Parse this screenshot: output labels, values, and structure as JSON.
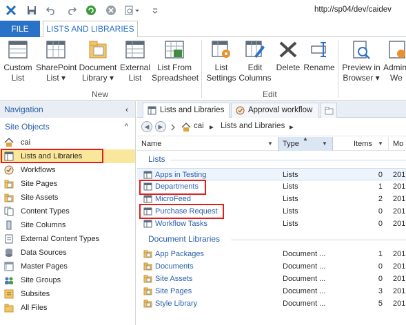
{
  "url": "http://sp04/dev/caidev",
  "tabs": {
    "file": "FILE",
    "active": "LISTS AND LIBRARIES"
  },
  "ribbon": {
    "new_group": "New",
    "edit_group": "Edit",
    "buttons": [
      {
        "line1": "Custom",
        "line2": "List"
      },
      {
        "line1": "SharePoint",
        "line2": "List ▾"
      },
      {
        "line1": "Document",
        "line2": "Library ▾"
      },
      {
        "line1": "External",
        "line2": "List"
      },
      {
        "line1": "List From",
        "line2": "Spreadsheet"
      },
      {
        "line1": "List",
        "line2": "Settings"
      },
      {
        "line1": "Edit",
        "line2": "Columns"
      },
      {
        "line1": "Delete",
        "line2": ""
      },
      {
        "line1": "Rename",
        "line2": ""
      },
      {
        "line1": "Preview in",
        "line2": "Browser ▾"
      },
      {
        "line1": "Admin",
        "line2": "We"
      }
    ]
  },
  "nav": {
    "header": "Navigation",
    "header_chevron": "‹",
    "section": "Site Objects",
    "section_chevron": "^",
    "items": [
      {
        "label": "cai"
      },
      {
        "label": "Lists and Libraries"
      },
      {
        "label": "Workflows"
      },
      {
        "label": "Site Pages"
      },
      {
        "label": "Site Assets"
      },
      {
        "label": "Content Types"
      },
      {
        "label": "Site Columns"
      },
      {
        "label": "External Content Types"
      },
      {
        "label": "Data Sources"
      },
      {
        "label": "Master Pages"
      },
      {
        "label": "Site Groups"
      },
      {
        "label": "Subsites"
      },
      {
        "label": "All Files"
      }
    ]
  },
  "doc_tabs": {
    "tab1": "Lists and Libraries",
    "tab2": "Approval workflow"
  },
  "breadcrumb": {
    "root": "cai",
    "sep": "▸",
    "current": "Lists and Libraries"
  },
  "columns": {
    "name": "Name",
    "type": "Type",
    "items": "Items",
    "modified": "Mo"
  },
  "sections": {
    "lists": "Lists",
    "doclibs": "Document Libraries"
  },
  "lists": [
    {
      "name": "Apps in Testing",
      "type": "Lists",
      "items": "0",
      "mod": "201"
    },
    {
      "name": "Departments",
      "type": "Lists",
      "items": "1",
      "mod": "201"
    },
    {
      "name": "MicroFeed",
      "type": "Lists",
      "items": "2",
      "mod": "201"
    },
    {
      "name": "Purchase Request",
      "type": "Lists",
      "items": "0",
      "mod": "201"
    },
    {
      "name": "Workflow Tasks",
      "type": "Lists",
      "items": "0",
      "mod": "201"
    }
  ],
  "libraries": [
    {
      "name": "App Packages",
      "type": "Document ...",
      "items": "1",
      "mod": "201"
    },
    {
      "name": "Documents",
      "type": "Document ...",
      "items": "0",
      "mod": "201"
    },
    {
      "name": "Site Assets",
      "type": "Document ...",
      "items": "0",
      "mod": "201"
    },
    {
      "name": "Site Pages",
      "type": "Document ...",
      "items": "3",
      "mod": "201"
    },
    {
      "name": "Style Library",
      "type": "Document ...",
      "items": "5",
      "mod": "201"
    }
  ],
  "colors": {
    "accent": "#2a72c8",
    "link": "#2a5fa8",
    "selected": "#fbe79b",
    "highlight_box": "#e31c1c"
  }
}
